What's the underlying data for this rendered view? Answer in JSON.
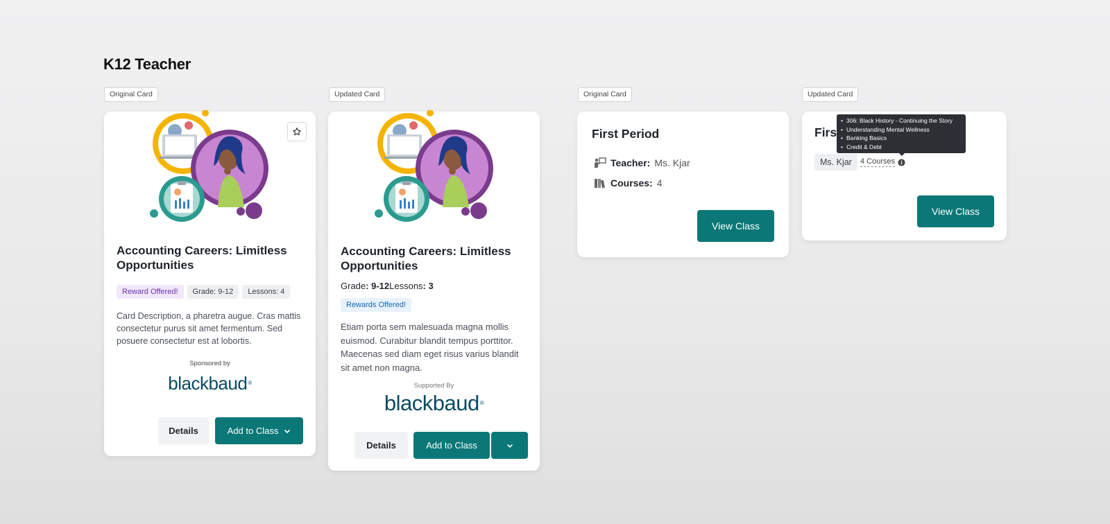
{
  "page": {
    "title": "K12 Teacher"
  },
  "tags": [
    "Original Card",
    "Updated Card",
    "Original Card",
    "Updated Card"
  ],
  "card1": {
    "title": "Accounting Careers: Limitless Opportunities",
    "chips": [
      "Reward Offered!",
      "Grade: 9-12",
      "Lessons: 4"
    ],
    "description": "Card Description, a pharetra augue. Cras mattis consectetur purus sit amet fermentum. Sed posuere consectetur est at lobortis.",
    "sponsor_label": "Sponsored by",
    "logo": "blackbaud",
    "details_label": "Details",
    "add_label": "Add to Class"
  },
  "card2": {
    "title": "Accounting Careers: Limitless Opportunities",
    "grade_label": "Grade",
    "grade_value": "9-12",
    "lessons_label": "Lessons",
    "lessons_value": "3",
    "reward_chip": "Rewards Offered!",
    "description": "Etiam porta sem malesuada magna mollis euismod. Curabitur blandit tempus porttitor. Maecenas sed diam eget risus varius blandit sit amet non magna.",
    "sponsor_label": "Supported By",
    "logo": "blackbaud",
    "details_label": "Details",
    "add_label": "Add to Class"
  },
  "card3": {
    "title": "First Period",
    "teacher_label": "Teacher:",
    "teacher_value": "Ms. Kjar",
    "courses_label": "Courses:",
    "courses_value": "4",
    "view_label": "View Class"
  },
  "card4": {
    "title": "First Period",
    "teacher_chip": "Ms. Kjar",
    "courses_link": "4 Courses",
    "view_label": "View Class",
    "tooltip_items": [
      "306: Black History - Continuing the Story",
      "Understanding Mental Wellness",
      "Banking Basics",
      "Credit & Debt"
    ]
  },
  "colors": {
    "teal": "#0b7777",
    "logo": "#0b4a62",
    "purple": "#7a3b8c",
    "gold": "#f5b400"
  }
}
